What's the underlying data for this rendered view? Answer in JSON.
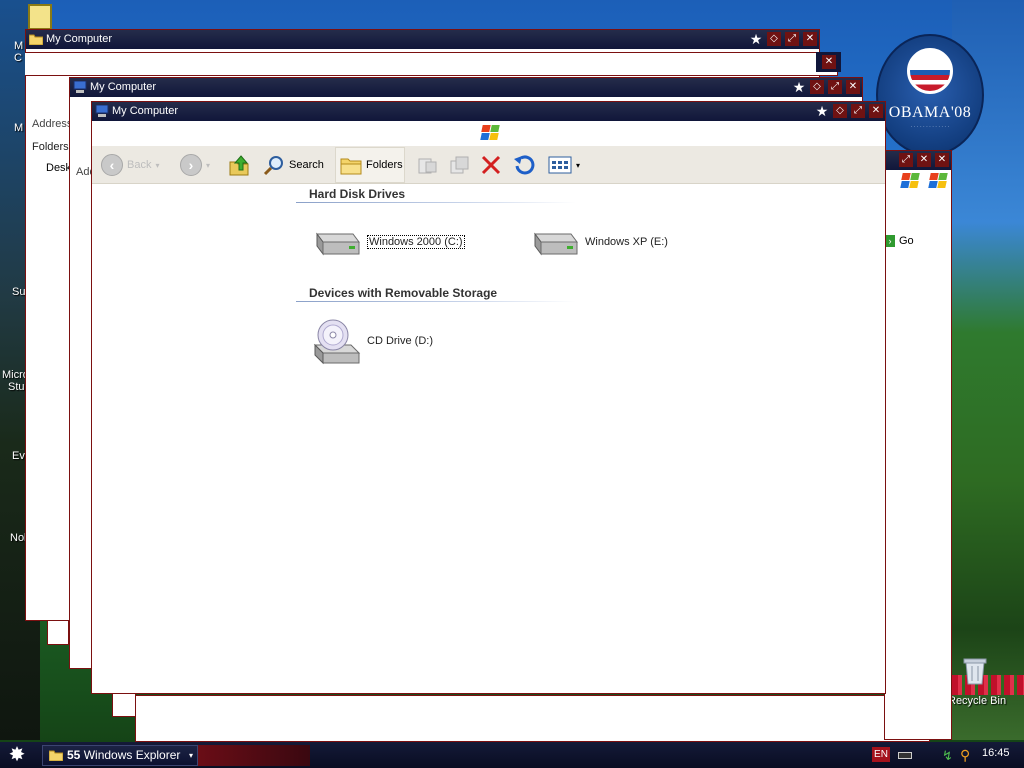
{
  "desktop": {
    "badge": {
      "text": "OBAMA'08"
    },
    "labels": [
      "M",
      "C",
      "M",
      "Su",
      "Micro",
      "Stu",
      "Ev",
      "Nol"
    ],
    "recycle_bin_label": "Recycle Bin"
  },
  "windows": {
    "back": {
      "title": "My Computer",
      "address_label": "Address",
      "folders_label": "Folders",
      "tree_first": "Desk"
    },
    "middle": {
      "title": "My Computer",
      "address_label": "Add"
    },
    "right_hidden": {
      "go_label": "Go"
    },
    "front": {
      "title": "My Computer",
      "toolbar": {
        "back_label": "Back",
        "search_label": "Search",
        "folders_label": "Folders"
      },
      "sections": [
        {
          "header": "Hard Disk Drives"
        },
        {
          "header": "Devices with Removable Storage"
        }
      ],
      "drives": [
        {
          "label": "Windows 2000 (C:)",
          "type": "hard-disk",
          "selected": true
        },
        {
          "label": "Windows XP (E:)",
          "type": "hard-disk",
          "selected": false
        },
        {
          "label": "CD Drive (D:)",
          "type": "cd-drive",
          "selected": false
        }
      ]
    }
  },
  "taskbar": {
    "task_count": "55",
    "task_label": "Windows Explorer",
    "language": "EN",
    "clock": "16:45"
  },
  "colors": {
    "titlebar": "#10163a",
    "window_border": "#7b1010",
    "toolbar_bg": "#ece9e2",
    "section_header": "#333333"
  }
}
